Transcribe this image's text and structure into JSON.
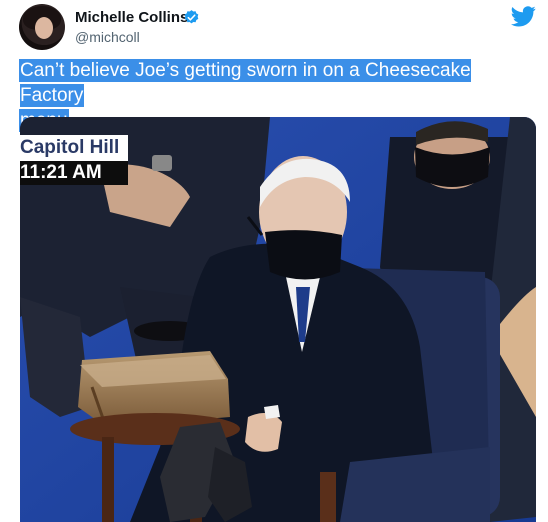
{
  "author": {
    "display_name": "Michelle Collins",
    "handle": "@michcoll",
    "verified": true
  },
  "tweet": {
    "text_line1": "Can’t believe Joe’s getting sworn in on a Cheesecake Factory",
    "text_line2": "menu"
  },
  "media": {
    "chyron_location": "Capitol Hill",
    "chyron_time": "11:21 AM"
  },
  "colors": {
    "twitter_blue": "#1d9bf0",
    "selection_highlight": "#3b8fe8"
  },
  "icons": [
    "verified-badge-icon",
    "twitter-bird-icon"
  ]
}
